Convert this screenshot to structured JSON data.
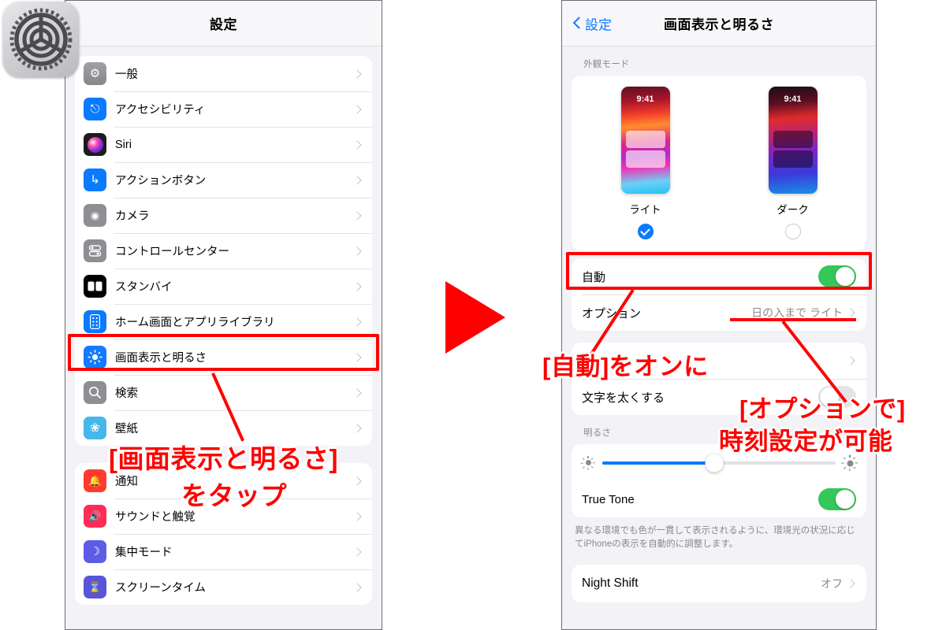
{
  "left_phone": {
    "nav": {
      "title": "設定"
    },
    "groups": [
      {
        "rows": [
          {
            "label": "一般",
            "icon": "gear-icon",
            "glyph": "⚙"
          },
          {
            "label": "アクセシビリティ",
            "icon": "accessibility-icon",
            "glyph": "Ⓘ"
          },
          {
            "label": "Siri",
            "icon": "siri-icon",
            "glyph": ""
          },
          {
            "label": "アクションボタン",
            "icon": "action-button-icon",
            "glyph": "↱"
          },
          {
            "label": "カメラ",
            "icon": "camera-icon",
            "glyph": "▣"
          },
          {
            "label": "コントロールセンター",
            "icon": "control-center-icon",
            "glyph": "≡"
          },
          {
            "label": "スタンバイ",
            "icon": "standby-icon",
            "glyph": "▭"
          },
          {
            "label": "ホーム画面とアプリライブラリ",
            "icon": "home-screen-icon",
            "glyph": "▯"
          },
          {
            "label": "画面表示と明るさ",
            "icon": "display-brightness-icon",
            "glyph": ""
          },
          {
            "label": "検索",
            "icon": "search-icon",
            "glyph": "⚲"
          },
          {
            "label": "壁紙",
            "icon": "wallpaper-icon",
            "glyph": "❀"
          }
        ]
      },
      {
        "rows": [
          {
            "label": "通知",
            "icon": "notifications-icon",
            "glyph": "🔔"
          },
          {
            "label": "サウンドと触覚",
            "icon": "sounds-haptics-icon",
            "glyph": "🔊"
          },
          {
            "label": "集中モード",
            "icon": "focus-mode-icon",
            "glyph": "☽"
          },
          {
            "label": "スクリーンタイム",
            "icon": "screen-time-icon",
            "glyph": "⌛"
          }
        ]
      }
    ],
    "annotation": {
      "line1": "[画面表示と明るさ]",
      "line2": "をタップ"
    }
  },
  "right_phone": {
    "nav": {
      "back_label": "設定",
      "title": "画面表示と明るさ"
    },
    "appearance": {
      "section_header": "外観モード",
      "modes": [
        {
          "label": "ライト",
          "time": "9:41",
          "selected": true
        },
        {
          "label": "ダーク",
          "time": "9:41",
          "selected": false
        }
      ]
    },
    "auto_group": [
      {
        "label": "自動",
        "type": "toggle",
        "value": "on"
      },
      {
        "label": "オプション",
        "type": "value",
        "value": "日の入まで ライト"
      }
    ],
    "text_group": [
      {
        "label": "",
        "type": "chevron",
        "value": ""
      },
      {
        "label": "文字を太くする",
        "type": "toggle",
        "value": "off"
      }
    ],
    "brightness": {
      "section_header": "明るさ",
      "slider_percent": 48,
      "true_tone_label": "True Tone",
      "true_tone_value": "on",
      "footnote": "異なる環境でも色が一貫して表示されるように、環境光の状況に応じてiPhoneの表示を自動的に調整します。"
    },
    "night_shift": {
      "label": "Night Shift",
      "value": "オフ"
    },
    "annotations": {
      "auto_on": "[自動]をオンに",
      "options_1": "[オプションで]",
      "options_2": "時刻設定が可能"
    }
  },
  "colors": {
    "accent_red": "#ff0000",
    "ios_blue": "#0a7aff",
    "toggle_green": "#34c759",
    "panel_bg": "#f2f2f7"
  }
}
